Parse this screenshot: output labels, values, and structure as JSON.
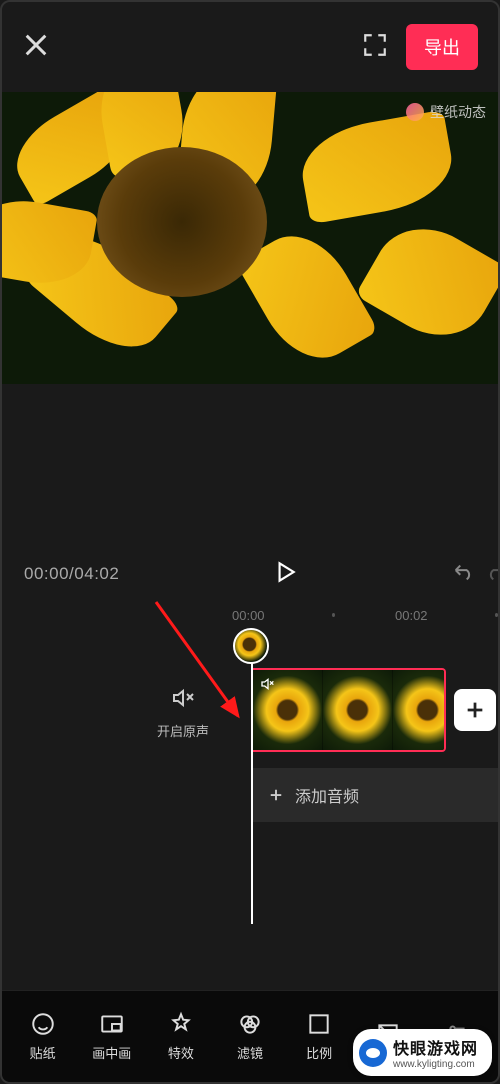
{
  "topbar": {
    "export_label": "导出"
  },
  "preview": {
    "watermark_text": "壁纸动态"
  },
  "playbar": {
    "current_time": "00:00",
    "total_time": "04:02"
  },
  "timeline": {
    "ticks": [
      "00:00",
      "00:02"
    ],
    "sound_toggle_label": "开启原声",
    "add_audio_label": "添加音频"
  },
  "tools": [
    {
      "name": "sticker",
      "label": "贴纸"
    },
    {
      "name": "pip",
      "label": "画中画"
    },
    {
      "name": "effects",
      "label": "特效"
    },
    {
      "name": "filter",
      "label": "滤镜"
    },
    {
      "name": "ratio",
      "label": "比例"
    },
    {
      "name": "canvas",
      "label": ""
    },
    {
      "name": "adjust",
      "label": ""
    }
  ],
  "site_watermark": {
    "title": "快眼游戏网",
    "url": "www.kyligting.com"
  }
}
